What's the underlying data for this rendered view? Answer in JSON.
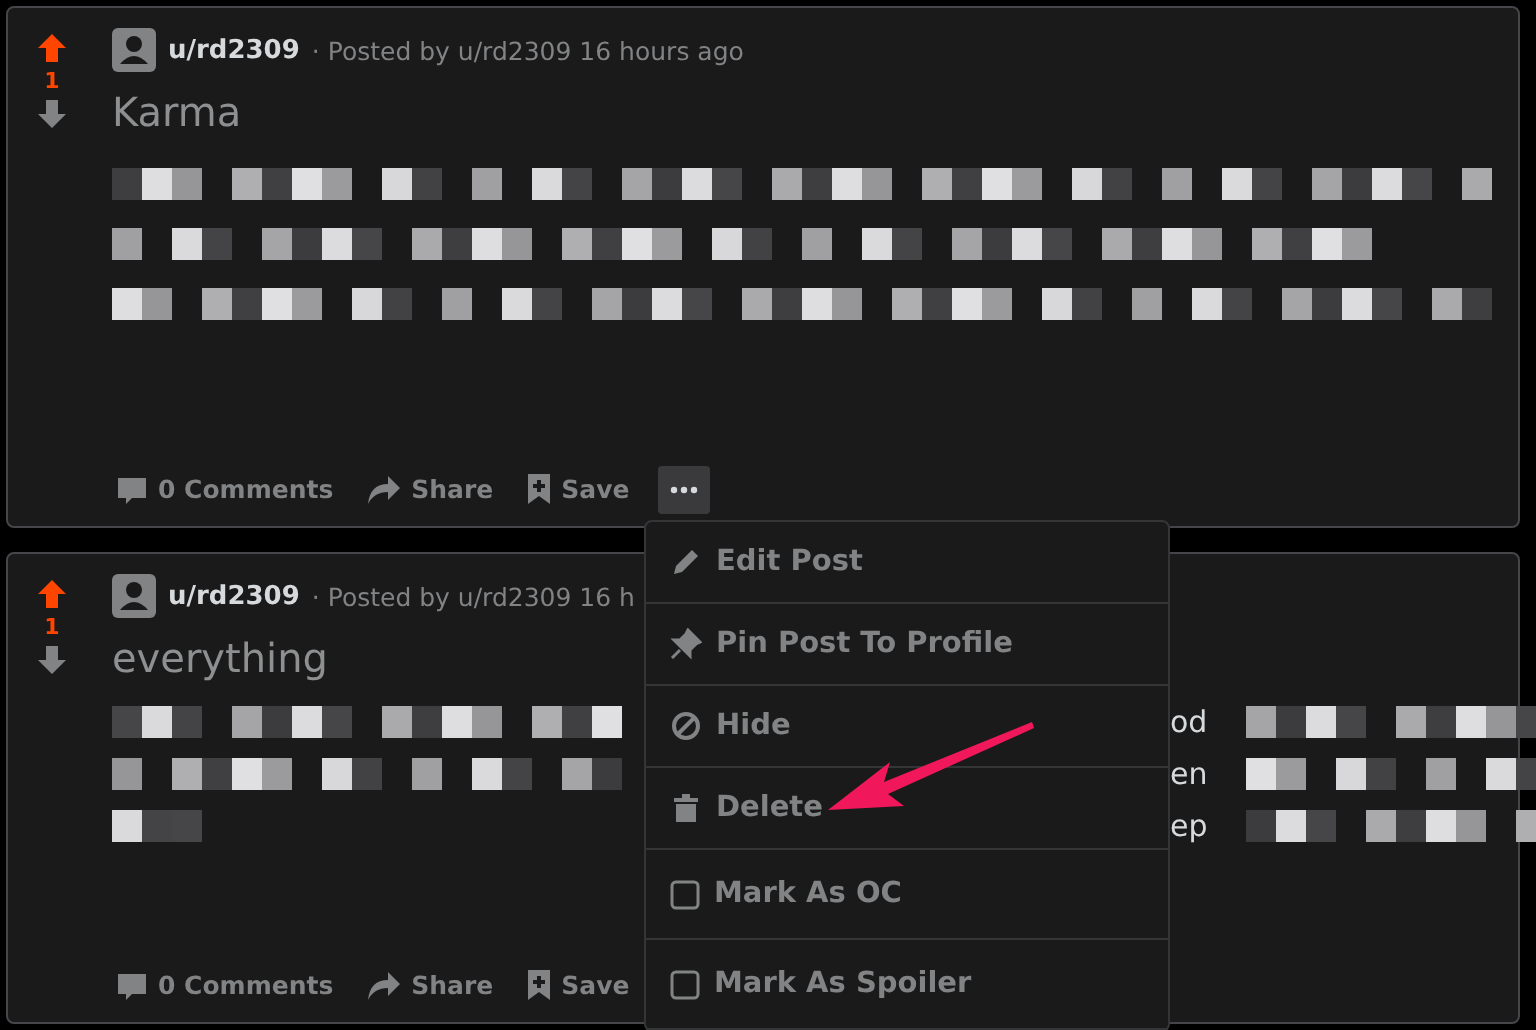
{
  "posts": [
    {
      "author": "u/rd2309",
      "meta": "· Posted by u/rd2309 16 hours ago",
      "votes": "1",
      "upvoted": true,
      "title": "Karma",
      "actions": {
        "comments": "0 Comments",
        "share": "Share",
        "save": "Save"
      },
      "menu_open": true
    },
    {
      "author": "u/rd2309",
      "meta": "· Posted by u/rd2309 16 h",
      "votes": "1",
      "upvoted": true,
      "title": "everything",
      "fragments": [
        "od",
        "en",
        "ep"
      ],
      "actions": {
        "comments": "0 Comments",
        "share": "Share",
        "save": "Save"
      }
    }
  ],
  "menu": {
    "items": [
      {
        "kind": "edit",
        "label": "Edit Post"
      },
      {
        "kind": "pin",
        "label": "Pin Post To Profile"
      },
      {
        "kind": "hide",
        "label": "Hide"
      },
      {
        "kind": "delete",
        "label": "Delete"
      },
      {
        "kind": "checkbox",
        "label": "Mark As OC",
        "checked": false
      },
      {
        "kind": "checkbox",
        "label": "Mark As Spoiler",
        "checked": false
      }
    ]
  }
}
